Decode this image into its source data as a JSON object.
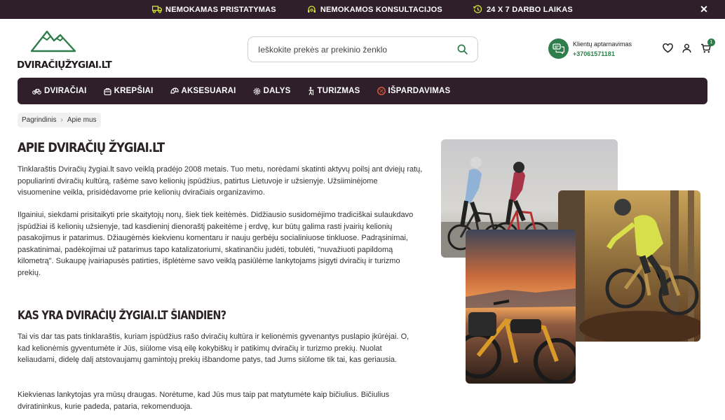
{
  "topbar": {
    "items": [
      {
        "label": "NEMOKAMAS PRISTATYMAS",
        "icon": "truck-icon"
      },
      {
        "label": "NEMOKAMOS KONSULTACIJOS",
        "icon": "headset-icon"
      },
      {
        "label": "24 X 7 DARBO LAIKAS",
        "icon": "clock-icon"
      }
    ],
    "close": "✕"
  },
  "logo": {
    "text": "DVIRAČIŲŽYGIAI.LT"
  },
  "search": {
    "placeholder": "Ieškokite prekės ar prekinio ženklo"
  },
  "support": {
    "label": "Klientų aptarnavimas",
    "phone": "+37061571181"
  },
  "cart": {
    "count": "1"
  },
  "nav": {
    "items": [
      {
        "label": "DVIRAČIAI",
        "icon": "bike-icon"
      },
      {
        "label": "KREPŠIAI",
        "icon": "bag-icon"
      },
      {
        "label": "AKSESUARAI",
        "icon": "helmet-icon"
      },
      {
        "label": "DALYS",
        "icon": "gear-icon"
      },
      {
        "label": "TURIZMAS",
        "icon": "hiker-icon"
      },
      {
        "label": "IŠPARDAVIMAS",
        "icon": "sale-icon"
      }
    ]
  },
  "breadcrumb": {
    "home": "Pagrindinis",
    "current": "Apie mus"
  },
  "content": {
    "title": "APIE DVIRAČIŲ ŽYGIAI.LT",
    "p1": "Tinklaraštis Dviračių žygiai.lt savo veiklą pradėjo 2008 metais. Tuo metu, norėdami skatinti aktyvų poilsį ant dviejų ratų, populiarinti dviračių kultūrą, rašėme savo kelionių įspūdžius, patirtus Lietuvoje ir užsienyje. Užsiiminėjome visuomenine veikla, prisidėdavome prie kelionių dviračiais organizavimo.",
    "p2": "Ilgainiui, siekdami prisitaikyti prie skaitytojų norų, šiek tiek keitėmės. Didžiausio susidomėjimo tradiciškai sulaukdavo įspūdžiai iš kelionių užsienyje, tad kasdieninį dienoraštį pakeitėme į erdvę, kur būtų galima rasti įvairių kelionių pasakojimus ir patarimus. Džiaugėmės kiekvienu komentaru ir nauju gerbėju socialiniuose tinkluose. Padrąsinimai, paskatinimai, padėkojimai už patarimus tapo katalizatoriumi, skatinančiu judėti, tobulėti, \"nuvažiuoti papildomą kilometrą\".  Sukaupę įvairiapusės patirties, išplėtėme savo veiklą pasiūlėme lankytojams įsigyti dviračių ir turizmo prekių.",
    "subtitle": "KAS YRA DVIRAČIŲ ŽYGIAI.LT ŠIANDIEN?",
    "p3": "Tai vis dar tas pats tinklaraštis, kuriam įspūdžius rašo dviračių kultūra ir kelionėmis gyvenantys puslapio įkūrėjai. O, kad kelionėmis gyventumėte ir Jūs, siūlome visą eilę kokybiškų ir patikimų dviračių ir turizmo prekių. Nuolat keliaudami, didelę dalį atstovaujamų gamintojų prekių išbandome patys, tad Jums siūlome tik tai, kas geriausia.",
    "p4": "Kiekvienas  lankytojas yra mūsų draugas. Norėtume, kad Jūs mus taip pat matytumėte kaip bičiulius. Bičiulius dviratininkus, kurie padeda, pataria, rekomenduoja."
  },
  "colors": {
    "brand_dark": "#2f1f2a",
    "accent_green": "#2e7d4a",
    "accent_yellow": "#d9ea2c"
  }
}
